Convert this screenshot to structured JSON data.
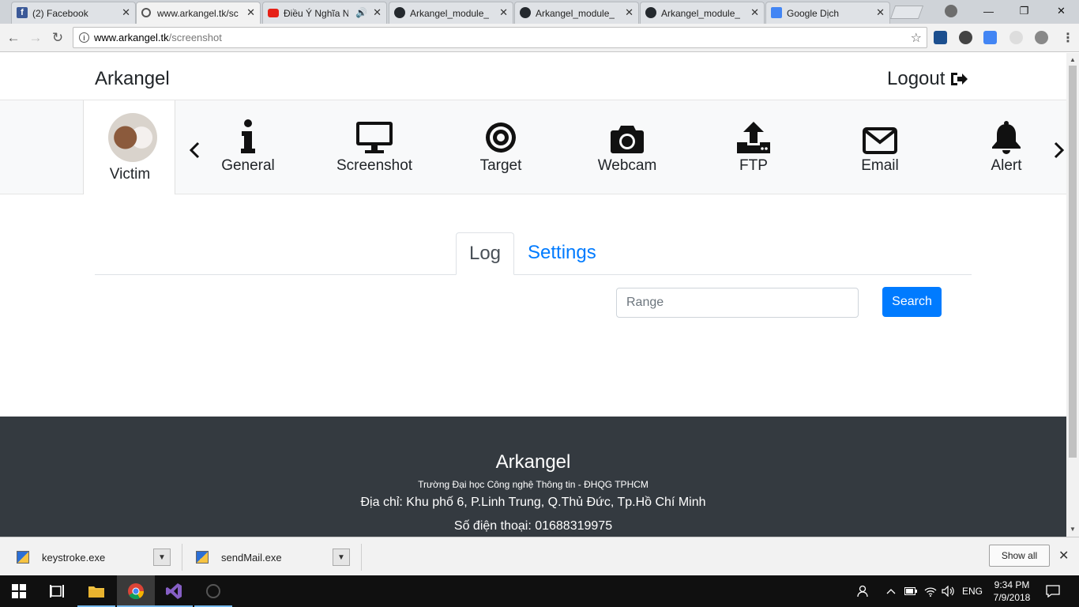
{
  "browser": {
    "tabs": [
      {
        "title": "(2) Facebook",
        "favicon": "facebook-icon",
        "color": "#3b5998"
      },
      {
        "title": "www.arkangel.tk/sc",
        "favicon": "chrome-tab-icon",
        "color": "#555555"
      },
      {
        "title": "Điều Ý Nghĩa N",
        "favicon": "youtube-icon",
        "color": "#e62117"
      },
      {
        "title": "Arkangel_module_",
        "favicon": "github-icon",
        "color": "#24292e"
      },
      {
        "title": "Arkangel_module_",
        "favicon": "github-icon",
        "color": "#24292e"
      },
      {
        "title": "Arkangel_module_",
        "favicon": "github-icon",
        "color": "#24292e"
      },
      {
        "title": "Google Dịch",
        "favicon": "google-translate-icon",
        "color": "#4285f4"
      }
    ],
    "url_host": "www.arkangel.tk",
    "url_path": "/screenshot"
  },
  "site": {
    "brand": "Arkangel",
    "logout_label": "Logout",
    "victim_label": "Victim",
    "nav": [
      {
        "label": "General",
        "icon": "info-icon"
      },
      {
        "label": "Screenshot",
        "icon": "monitor-icon"
      },
      {
        "label": "Target",
        "icon": "target-icon"
      },
      {
        "label": "Webcam",
        "icon": "camera-icon"
      },
      {
        "label": "FTP",
        "icon": "upload-icon"
      },
      {
        "label": "Email",
        "icon": "envelope-icon"
      },
      {
        "label": "Alert",
        "icon": "bell-icon"
      }
    ],
    "tabs": {
      "log": "Log",
      "settings": "Settings"
    },
    "range_placeholder": "Range",
    "search_label": "Search",
    "accent": "#007bff"
  },
  "footer": {
    "title": "Arkangel",
    "school": "Trường Đại học Công nghệ Thông tin - ĐHQG TPHCM",
    "address": "Địa chỉ: Khu phố 6, P.Linh Trung, Q.Thủ Đức, Tp.Hồ Chí Minh",
    "phone": "Số điện thoại: 01688319975"
  },
  "downloads": {
    "items": [
      "keystroke.exe",
      "sendMail.exe"
    ],
    "show_all": "Show all"
  },
  "taskbar": {
    "language": "ENG",
    "time": "9:34 PM",
    "date": "7/9/2018"
  }
}
